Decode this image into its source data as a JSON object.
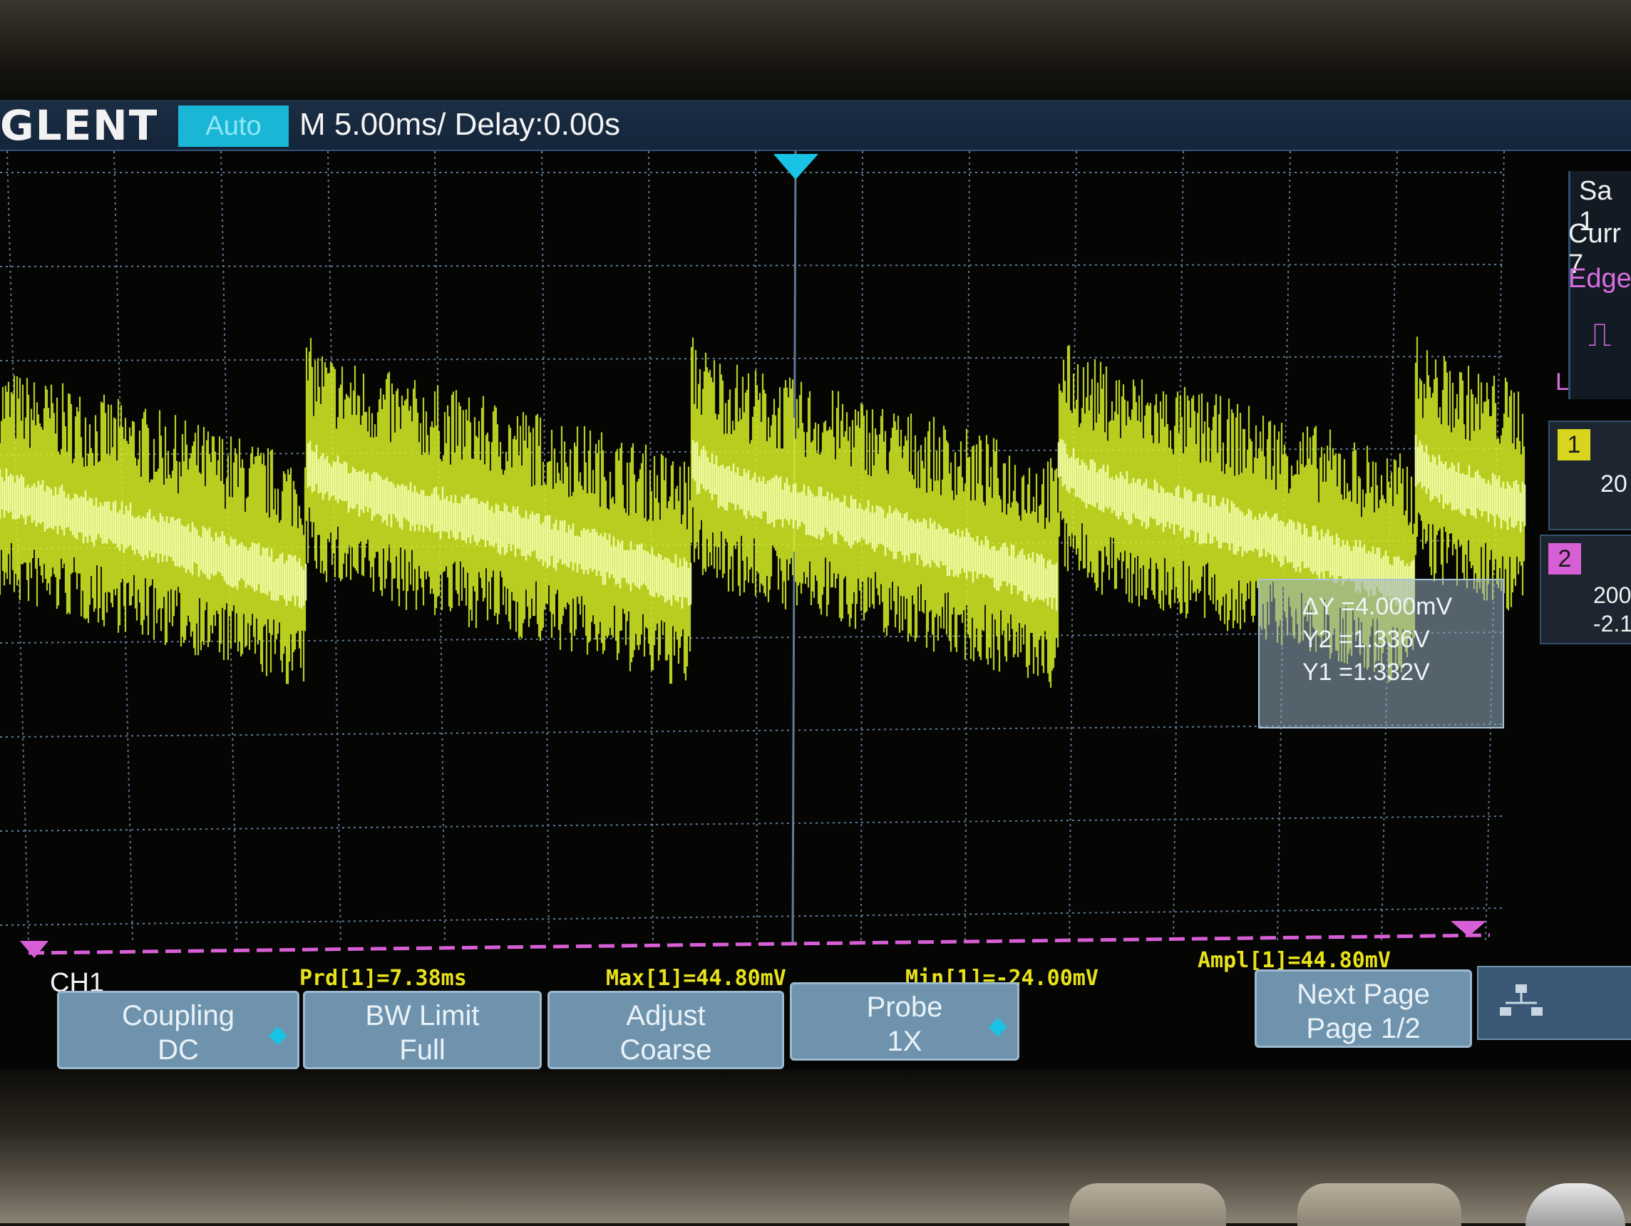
{
  "header": {
    "brand": "GLENT",
    "trigger_mode": "Auto",
    "timebase": "M 5.00ms/ Delay:0.00s"
  },
  "right_panel": {
    "sample_rate_label": "Sa 1",
    "curr_label": "Curr 7",
    "trigger_type": "Edge",
    "trigger_level_label": "L",
    "channel1_badge": "1",
    "channel1_scale": "20",
    "channel2_badge": "2",
    "channel2_scale": "200",
    "channel2_offset": "-2.1"
  },
  "cursor_readout": {
    "delta_y": "ΔY =4.000mV",
    "y2": "Y2 =1.336V",
    "y1": "Y1 =1.332V"
  },
  "measurements": {
    "period": "Prd[1]=7.38ms",
    "max": "Max[1]=44.80mV",
    "min": "Min[1]=-24.00mV",
    "amplitude": "Ampl[1]=44.80mV"
  },
  "menu": {
    "channel_label": "CH1",
    "coupling_title": "Coupling",
    "coupling_value": "DC",
    "bw_limit_title": "BW Limit",
    "bw_limit_value": "Full",
    "adjust_title": "Adjust",
    "adjust_value": "Coarse",
    "probe_title": "Probe",
    "probe_value": "1X",
    "next_page_title": "Next Page",
    "next_page_value": "Page 1/2"
  },
  "colors": {
    "trace": "#d8f026",
    "trace_core": "#f6ffb0",
    "grid": "#5e7a96",
    "trigger_marker": "#19c3e6",
    "reference_marker": "#d75fd6",
    "measurement_text": "#e8e21a"
  },
  "icons": {
    "trigger_position": "down-triangle-marker",
    "trigger_edge": "rising-edge-icon",
    "ground_marker": "ground-reference-marker",
    "network": "network-icon"
  }
}
